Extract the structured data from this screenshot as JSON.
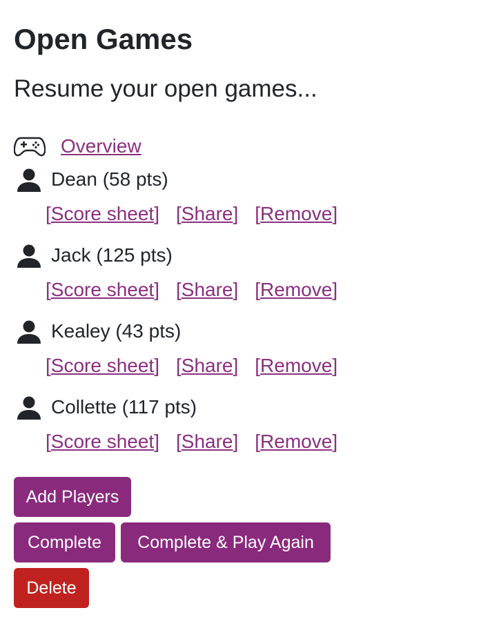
{
  "header": {
    "title": "Open Games",
    "subtitle": "Resume your open games..."
  },
  "overview": {
    "icon": "gamepad-icon",
    "label": "Overview"
  },
  "players": [
    {
      "label": "Dean (58 pts)",
      "links": {
        "score": "Score sheet",
        "share": "Share",
        "remove": "Remove"
      }
    },
    {
      "label": "Jack (125 pts)",
      "links": {
        "score": "Score sheet",
        "share": "Share",
        "remove": "Remove"
      }
    },
    {
      "label": "Kealey (43 pts)",
      "links": {
        "score": "Score sheet",
        "share": "Share",
        "remove": "Remove"
      }
    },
    {
      "label": "Collette (117 pts)",
      "links": {
        "score": "Score sheet",
        "share": "Share",
        "remove": "Remove"
      }
    }
  ],
  "actions": {
    "add_players": "Add Players",
    "complete": "Complete",
    "complete_play_again": "Complete & Play Again",
    "delete": "Delete"
  },
  "colors": {
    "link": "#8a2f80",
    "primary_button": "#8a2a7d",
    "danger_button": "#c0231f",
    "text": "#212529"
  }
}
